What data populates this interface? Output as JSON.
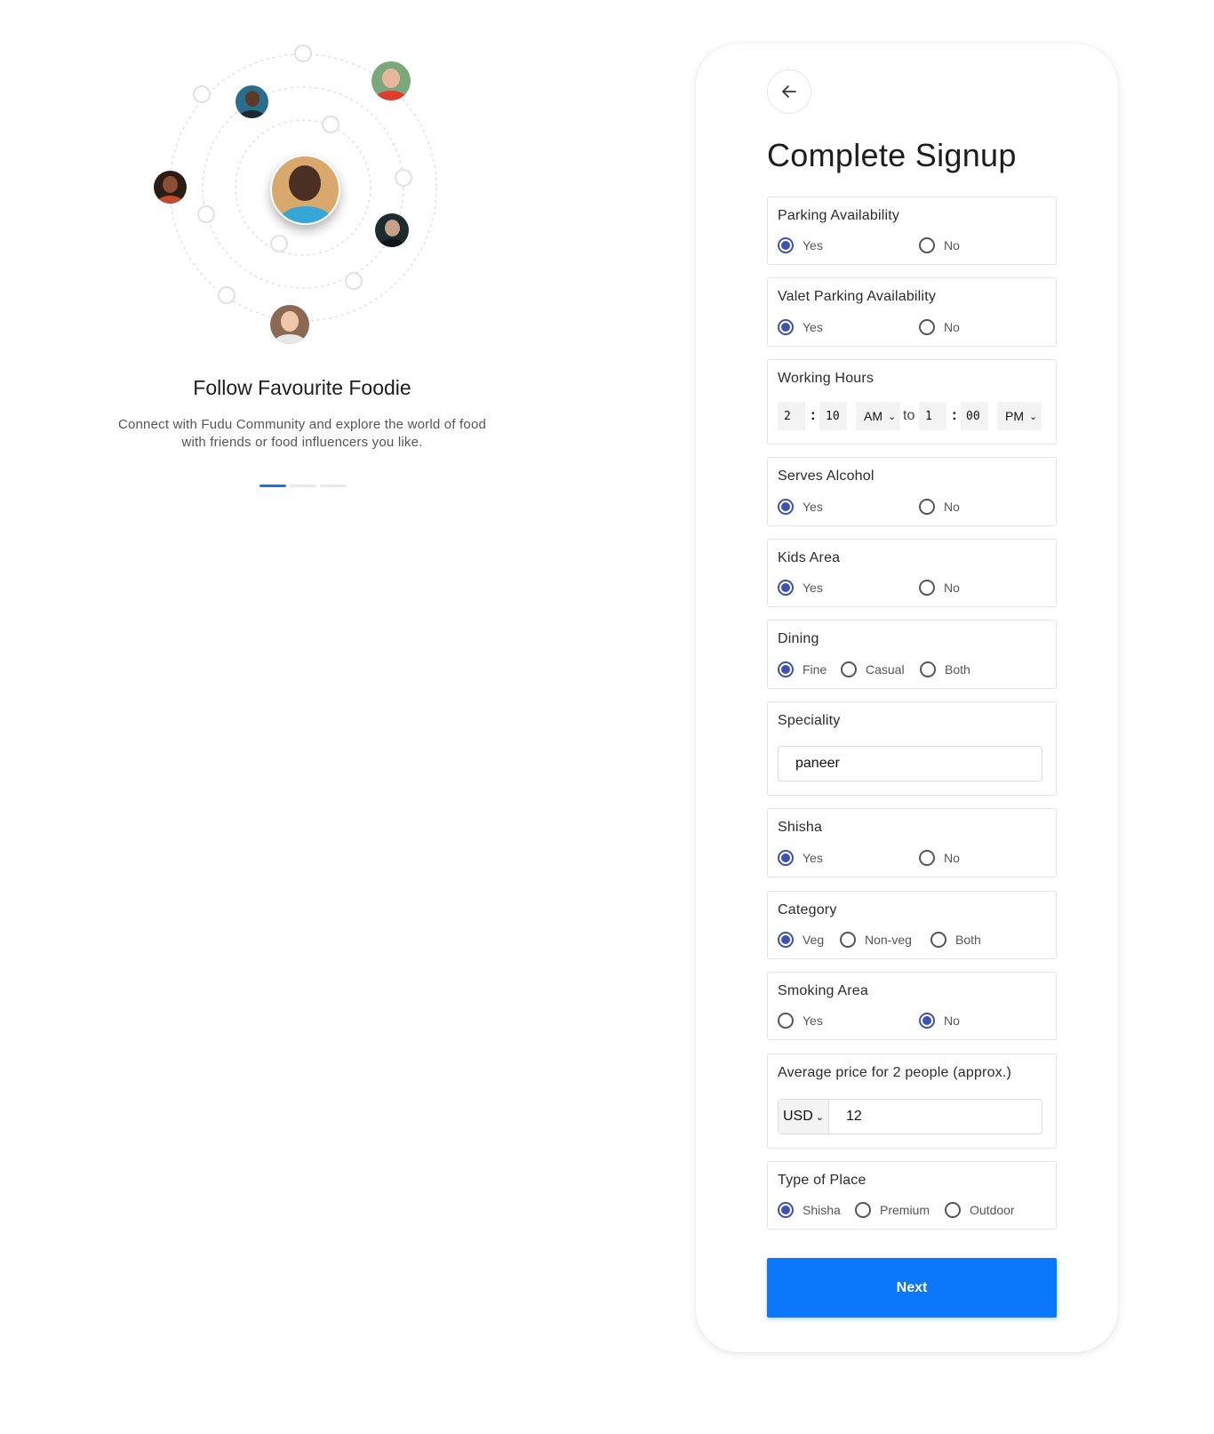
{
  "onboarding": {
    "title": "Follow Favourite Foodie",
    "description": "Connect with Fudu Community and explore the world of food with friends or food influencers you like.",
    "slides": 3,
    "active_slide": 1
  },
  "form": {
    "title": "Complete Signup",
    "back_icon": "arrow-left-icon",
    "parking": {
      "label": "Parking Availability",
      "options": [
        "Yes",
        "No"
      ],
      "selected": "Yes"
    },
    "valet": {
      "label": "Valet Parking Availability",
      "options": [
        "Yes",
        "No"
      ],
      "selected": "Yes"
    },
    "working_hours": {
      "label": "Working Hours",
      "start_hour": "2",
      "start_minute": "10",
      "start_period": "AM",
      "separator": "to",
      "end_hour": "1",
      "end_minute": "00",
      "end_period": "PM"
    },
    "alcohol": {
      "label": "Serves Alcohol",
      "options": [
        "Yes",
        "No"
      ],
      "selected": "Yes"
    },
    "kids": {
      "label": "Kids Area",
      "options": [
        "Yes",
        "No"
      ],
      "selected": "Yes"
    },
    "dining": {
      "label": "Dining",
      "options": [
        "Fine",
        "Casual",
        "Both"
      ],
      "selected": "Fine"
    },
    "speciality": {
      "label": "Speciality",
      "value": "paneer"
    },
    "shisha": {
      "label": "Shisha",
      "options": [
        "Yes",
        "No"
      ],
      "selected": "Yes"
    },
    "category": {
      "label": "Category",
      "options": [
        "Veg",
        "Non-veg",
        "Both"
      ],
      "selected": "Veg"
    },
    "smoking": {
      "label": "Smoking Area",
      "options": [
        "Yes",
        "No"
      ],
      "selected": "No"
    },
    "price": {
      "label": "Average price for 2 people (approx.)",
      "currency": "USD",
      "value": "12"
    },
    "place_type": {
      "label": "Type of Place",
      "options": [
        "Shisha",
        "Premium",
        "Outdoor"
      ],
      "selected": "Shisha"
    },
    "next_label": "Next"
  },
  "colors": {
    "accent": "#0b77fb",
    "radio": "#3f51b5",
    "active_dot": "#1a73e8"
  }
}
